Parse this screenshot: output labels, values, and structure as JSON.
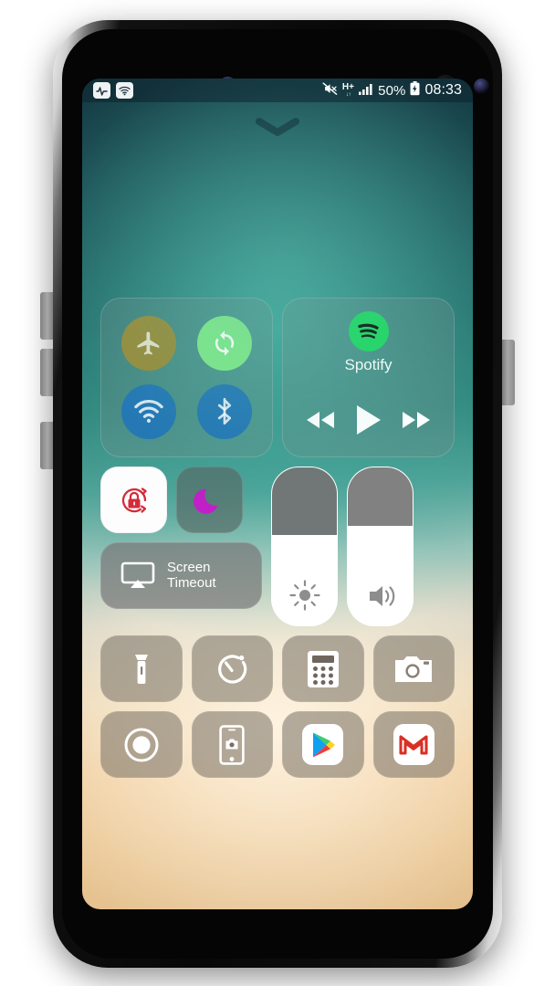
{
  "device": {
    "model_style": "galaxy-s8",
    "buttons": [
      "volume-up",
      "volume-down",
      "bixby",
      "power"
    ]
  },
  "status_bar": {
    "left_icons": [
      "activity-badge-icon",
      "wifi-badge-icon"
    ],
    "mute_icon": "mute-icon",
    "network_type": "H+",
    "signal_icon": "signal-bars-icon",
    "battery_percent": "50%",
    "battery_icon": "battery-icon",
    "time": "08:33"
  },
  "handle": {
    "icon": "chevron-down-icon"
  },
  "control_center": {
    "connectivity": {
      "toggles": [
        {
          "id": "airplane",
          "label": "Airplane Mode",
          "icon": "airplane-icon",
          "active": false,
          "color": "#968c3c"
        },
        {
          "id": "sync",
          "label": "Auto Sync",
          "icon": "sync-icon",
          "active": true,
          "color": "#7ee787"
        },
        {
          "id": "wifi",
          "label": "Wi-Fi",
          "icon": "wifi-icon",
          "active": true,
          "color": "#2478b4"
        },
        {
          "id": "bluetooth",
          "label": "Bluetooth",
          "icon": "bluetooth-icon",
          "active": true,
          "color": "#2478b4"
        }
      ]
    },
    "music": {
      "app_name": "Spotify",
      "app_icon": "spotify-icon",
      "brand_color": "#1ed760",
      "controls": [
        {
          "id": "previous",
          "label": "Previous",
          "icon": "rewind-icon"
        },
        {
          "id": "play",
          "label": "Play",
          "icon": "play-icon"
        },
        {
          "id": "next",
          "label": "Next",
          "icon": "fast-forward-icon"
        }
      ]
    },
    "toggles": [
      {
        "id": "rotation-lock",
        "label": "Rotation Lock",
        "icon": "rotation-lock-icon",
        "active": true,
        "color": "#d42b3a"
      },
      {
        "id": "night-mode",
        "label": "Night Mode",
        "icon": "moon-icon",
        "active": false,
        "color": "#c020c8"
      }
    ],
    "screen_timeout": {
      "label_line1": "Screen",
      "label_line2": "Timeout",
      "icon": "screen-mirroring-icon"
    },
    "sliders": [
      {
        "id": "brightness",
        "label": "Brightness",
        "icon": "brightness-icon",
        "value": 57,
        "min": 0,
        "max": 100
      },
      {
        "id": "volume",
        "label": "Volume",
        "icon": "volume-icon",
        "value": 63,
        "min": 0,
        "max": 100
      }
    ],
    "shortcuts_row1": [
      {
        "id": "flashlight",
        "label": "Flashlight",
        "icon": "flashlight-icon"
      },
      {
        "id": "timer",
        "label": "Timer",
        "icon": "timer-icon"
      },
      {
        "id": "calculator",
        "label": "Calculator",
        "icon": "calculator-icon"
      },
      {
        "id": "camera",
        "label": "Camera",
        "icon": "camera-icon"
      }
    ],
    "shortcuts_row2": [
      {
        "id": "screen-record",
        "label": "Screen Record",
        "icon": "record-icon"
      },
      {
        "id": "screenshot",
        "label": "Screenshot",
        "icon": "screenshot-icon"
      },
      {
        "id": "play-store",
        "label": "Google Play",
        "icon": "google-play-icon"
      },
      {
        "id": "gmail",
        "label": "Gmail",
        "icon": "gmail-icon"
      }
    ]
  }
}
